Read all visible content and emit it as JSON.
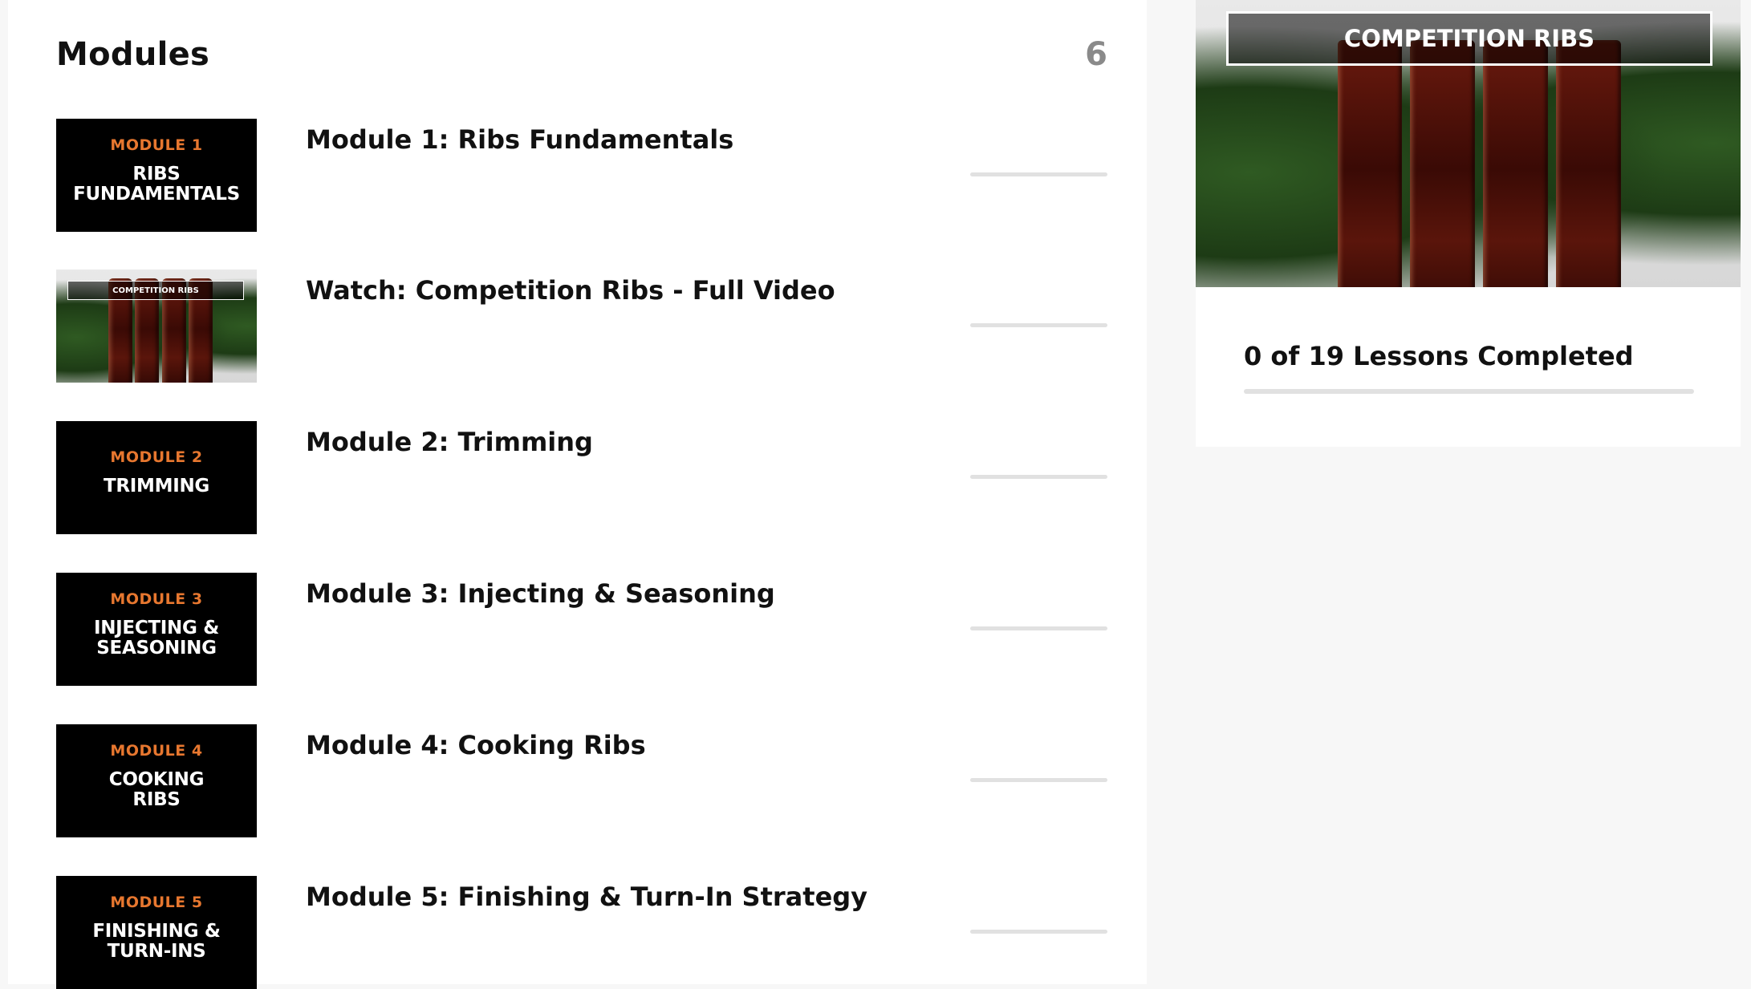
{
  "modules_header": {
    "title": "Modules",
    "count": "6"
  },
  "modules": [
    {
      "title": "Module 1: Ribs Fundamentals",
      "thumb_type": "text",
      "thumb_kicker": "MODULE 1",
      "thumb_name": "RIBS\nFUNDAMENTALS",
      "progress": 0
    },
    {
      "title": "Watch: Competition Ribs - Full Video",
      "thumb_type": "photo",
      "thumb_label": "COMPETITION RIBS",
      "progress": 0
    },
    {
      "title": "Module 2: Trimming",
      "thumb_type": "text",
      "thumb_kicker": "MODULE 2",
      "thumb_name": "TRIMMING",
      "progress": 0
    },
    {
      "title": "Module 3: Injecting & Seasoning",
      "thumb_type": "text",
      "thumb_kicker": "MODULE 3",
      "thumb_name": "INJECTING &\nSEASONING",
      "progress": 0
    },
    {
      "title": "Module 4: Cooking Ribs",
      "thumb_type": "text",
      "thumb_kicker": "MODULE 4",
      "thumb_name": "COOKING\nRIBS",
      "progress": 0
    },
    {
      "title": "Module 5: Finishing & Turn-In Strategy",
      "thumb_type": "text",
      "thumb_kicker": "MODULE 5",
      "thumb_name": "FINISHING &\nTURN-INS",
      "progress": 0
    }
  ],
  "sidebar": {
    "course_image_label": "COMPETITION RIBS",
    "lessons_completed_text": "0 of 19 Lessons Completed",
    "lessons_completed": 0,
    "lessons_total": 19
  },
  "colors": {
    "accent_orange": "#e7772f",
    "progress_track": "#e1e1e1",
    "thumb_bg": "#000000"
  }
}
